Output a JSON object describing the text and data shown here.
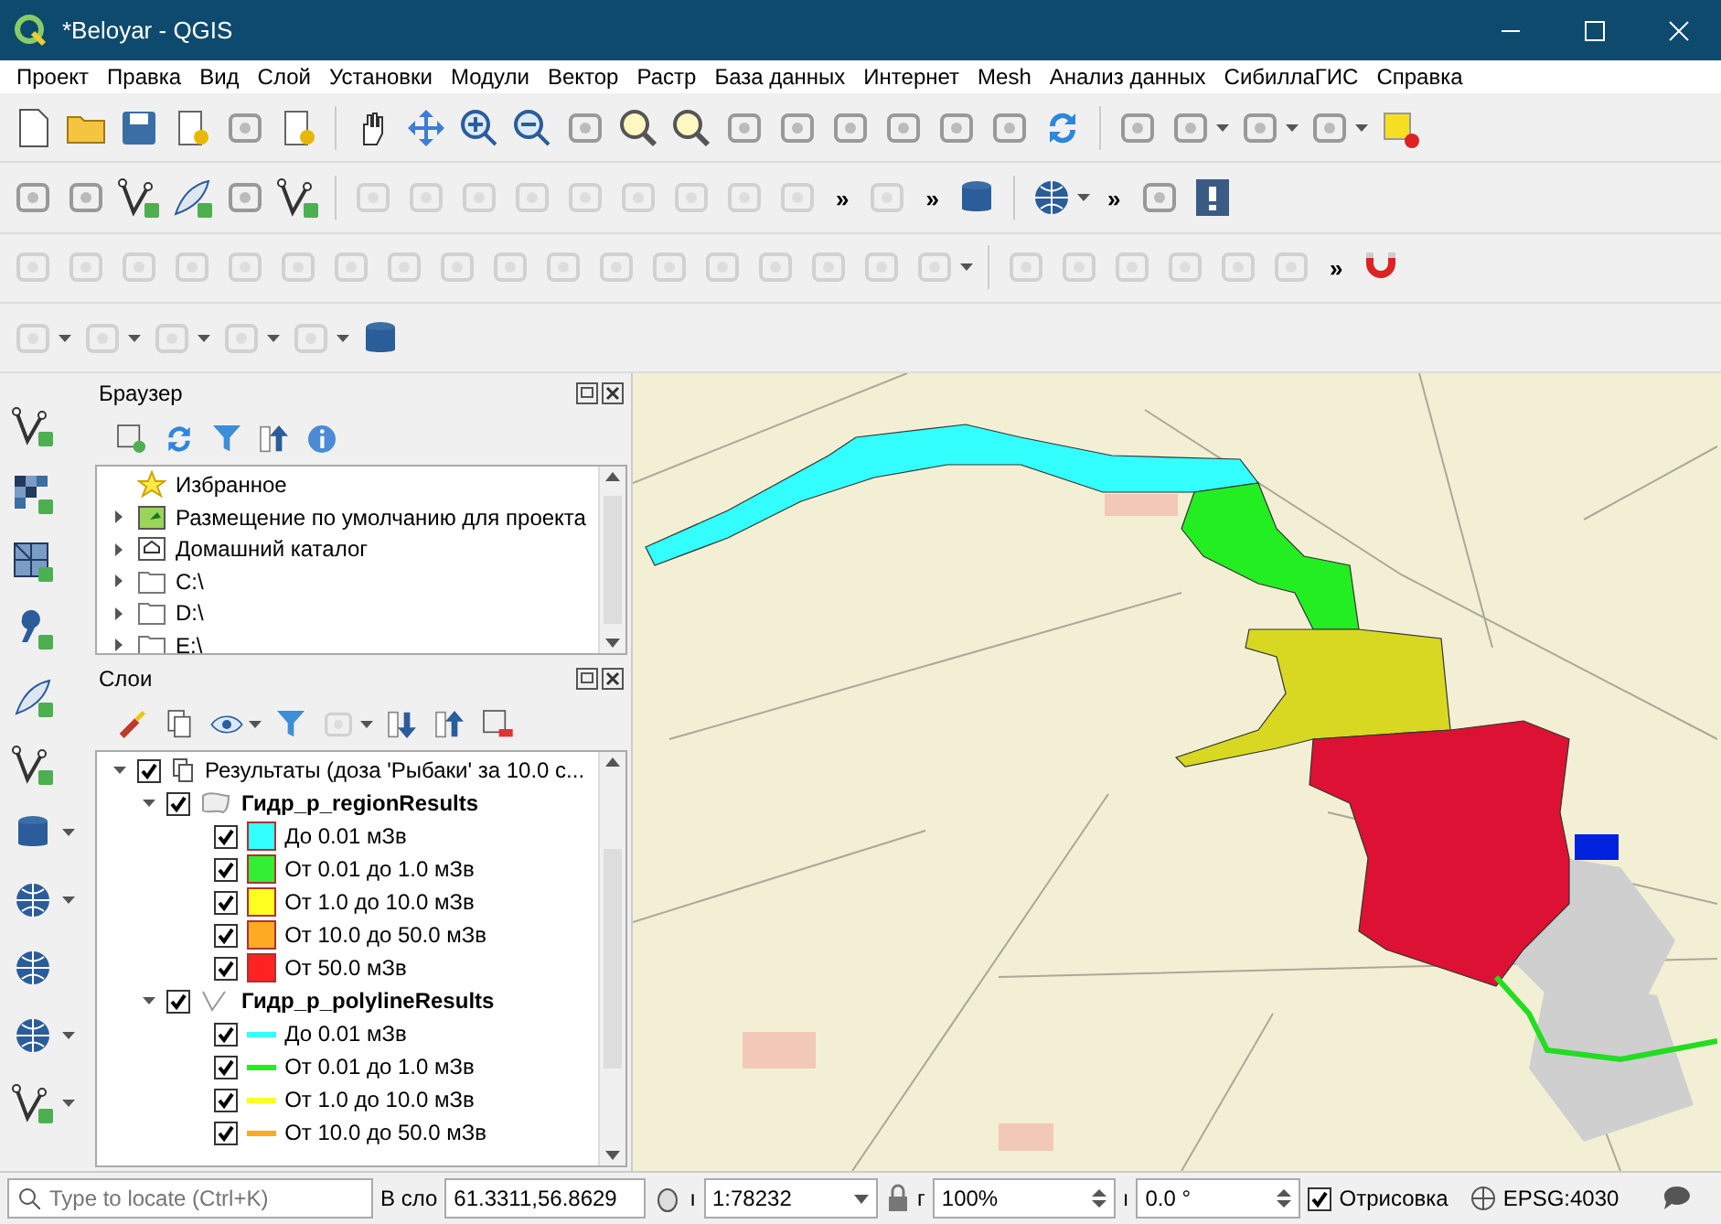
{
  "window": {
    "title": "*Beloyar - QGIS"
  },
  "menu": [
    {
      "label": "Проект"
    },
    {
      "label": "Правка"
    },
    {
      "label": "Вид"
    },
    {
      "label": "Слой"
    },
    {
      "label": "Установки"
    },
    {
      "label": "Модули"
    },
    {
      "label": "Вектор"
    },
    {
      "label": "Растр"
    },
    {
      "label": "База данных"
    },
    {
      "label": "Интернет"
    },
    {
      "label": "Mesh"
    },
    {
      "label": "Анализ данных"
    },
    {
      "label": "СибиллаГИС"
    },
    {
      "label": "Справка"
    }
  ],
  "toolbars": {
    "row_2": {
      "overflow": [
        "»",
        "»",
        "»"
      ]
    },
    "row_3": {
      "overflow": [
        "»"
      ]
    }
  },
  "browser": {
    "title": "Браузер",
    "items": [
      {
        "label": "Избранное",
        "kind": "favorites",
        "expandable": false
      },
      {
        "label": "Размещение по умолчанию для проекта",
        "kind": "project",
        "expandable": true
      },
      {
        "label": "Домашний каталог",
        "kind": "home",
        "expandable": true
      },
      {
        "label": "C:\\",
        "kind": "drive",
        "expandable": true
      },
      {
        "label": "D:\\",
        "kind": "drive",
        "expandable": true
      },
      {
        "label": "E:\\",
        "kind": "drive",
        "expandable": true
      }
    ]
  },
  "layers": {
    "title": "Слои",
    "tree": [
      {
        "label": "Результаты (доза 'Рыбаки' за 10.0 с...",
        "kind": "group",
        "checked": true,
        "expanded": true,
        "children": [
          {
            "label": "Гидр_р_regionResults",
            "kind": "polygon",
            "checked": true,
            "expanded": true,
            "children": [
              {
                "label": "До 0.01 мЗв",
                "kind": "fill",
                "checked": true,
                "color": "#33ffff"
              },
              {
                "label": "От 0.01 до 1.0 мЗв",
                "kind": "fill",
                "checked": true,
                "color": "#33ee33"
              },
              {
                "label": "От 1.0 до 10.0 мЗв",
                "kind": "fill",
                "checked": true,
                "color": "#ffff22"
              },
              {
                "label": "От 10.0 до 50.0 мЗв",
                "kind": "fill",
                "checked": true,
                "color": "#ffaa22"
              },
              {
                "label": "От 50.0 мЗв",
                "kind": "fill",
                "checked": true,
                "color": "#ff2222"
              }
            ]
          },
          {
            "label": "Гидр_р_polylineResults",
            "kind": "line",
            "checked": true,
            "expanded": true,
            "children": [
              {
                "label": "До 0.01 мЗв",
                "kind": "stroke",
                "checked": true,
                "color": "#33ffff"
              },
              {
                "label": "От 0.01 до 1.0 мЗв",
                "kind": "stroke",
                "checked": true,
                "color": "#22ee22"
              },
              {
                "label": "От 1.0 до 10.0 мЗв",
                "kind": "stroke",
                "checked": true,
                "color": "#ffff22"
              },
              {
                "label": "От 10.0 до 50.0 мЗв",
                "kind": "stroke",
                "checked": true,
                "color": "#ffaa22"
              }
            ]
          }
        ]
      }
    ]
  },
  "status_bar": {
    "locate_placeholder": "Type to locate (Ctrl+K)",
    "coordinate_label": "В сло",
    "coordinate": "61.3311,56.8629",
    "scale_label": "ı",
    "scale": "1:78232",
    "magnifier_label": "г",
    "magnifier": "100%",
    "rotation_label": "ı",
    "rotation": "0.0 °",
    "render": {
      "label": "Отрисовка",
      "checked": true
    },
    "crs": "EPSG:4030"
  }
}
